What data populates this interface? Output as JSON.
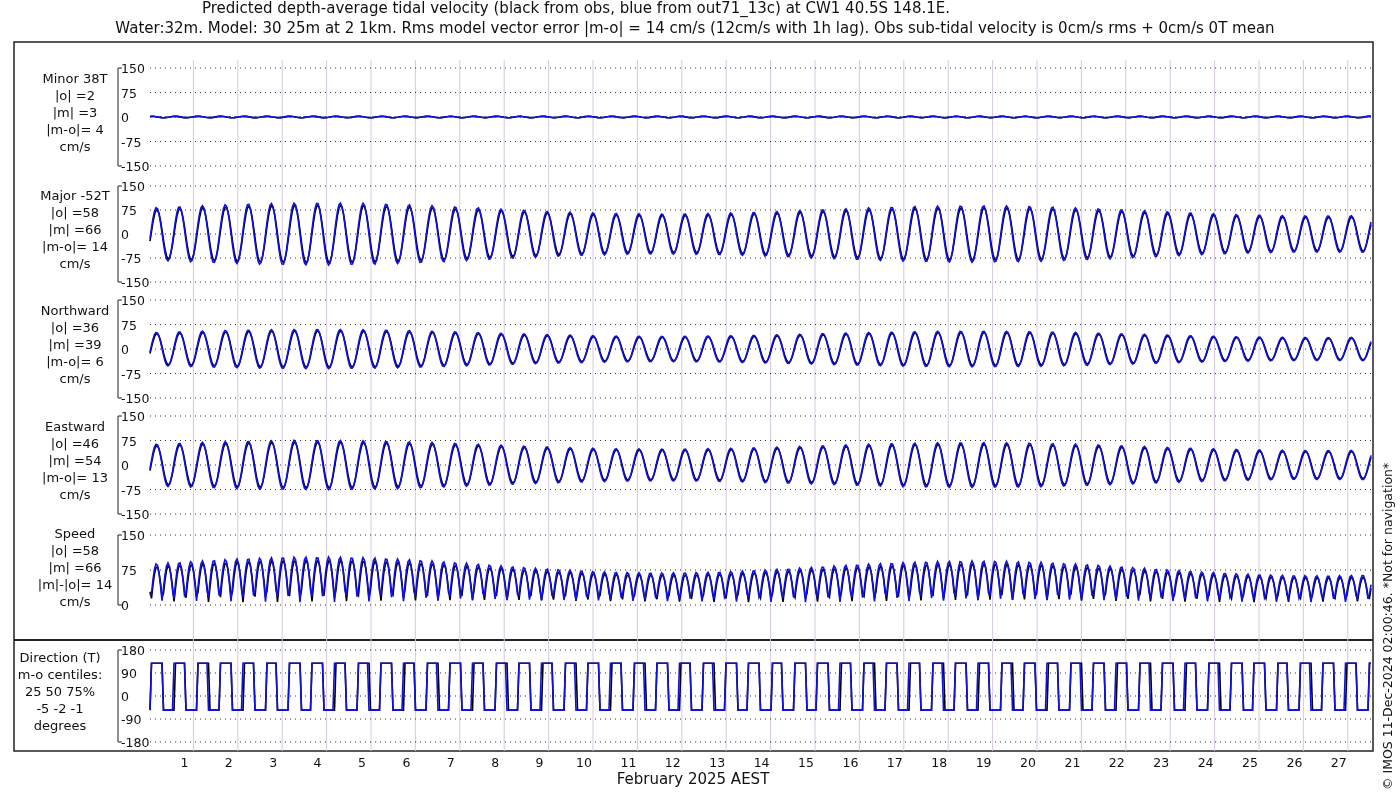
{
  "title_lines": [
    "Predicted depth-average tidal velocity (black from obs, blue from out71_13c) at CW1 40.5S 148.1E.",
    "Water:32m. Model: 30 25m at 2 1km. Rms model vector error |m-o| = 14 cm/s (12cm/s with 1h lag). Obs sub-tidal velocity is 0cm/s rms + 0cm/s 0T mean"
  ],
  "panels": [
    {
      "kind": "signed",
      "label_lines": [
        "Minor 38T",
        "|o| =2",
        "|m| =3",
        "|m-o|= 4",
        "cm/s"
      ],
      "ytick_labels": [
        "150",
        "75",
        "0",
        "-75",
        "-150"
      ]
    },
    {
      "kind": "signed",
      "label_lines": [
        "Major -52T",
        "|o| =58",
        "|m| =66",
        "|m-o|= 14",
        "cm/s"
      ],
      "ytick_labels": [
        "150",
        "75",
        "0",
        "-75",
        "-150"
      ]
    },
    {
      "kind": "signed",
      "label_lines": [
        "Northward",
        "|o| =36",
        "|m| =39",
        "|m-o|= 6",
        "cm/s"
      ],
      "ytick_labels": [
        "150",
        "75",
        "0",
        "-75",
        "-150"
      ]
    },
    {
      "kind": "signed",
      "label_lines": [
        "Eastward",
        "|o| =46",
        "|m| =54",
        "|m-o|= 13",
        "cm/s"
      ],
      "ytick_labels": [
        "150",
        "75",
        "0",
        "-75",
        "-150"
      ]
    },
    {
      "kind": "speed",
      "label_lines": [
        "Speed",
        "|o| =58",
        "|m| =66",
        "|m|-|o|= 14",
        "cm/s"
      ],
      "ytick_labels": [
        "150",
        "75",
        "0"
      ]
    },
    {
      "kind": "direction",
      "label_lines": [
        "Direction (T)",
        "m-o centiles:",
        "25  50  75%",
        "-5 -2 -1",
        "degrees"
      ],
      "ytick_labels": [
        "180",
        "90",
        "0",
        "-90",
        "-180"
      ]
    }
  ],
  "xtick_labels": [
    "1",
    "2",
    "3",
    "4",
    "5",
    "6",
    "7",
    "8",
    "9",
    "10",
    "11",
    "12",
    "13",
    "14",
    "15",
    "16",
    "17",
    "18",
    "19",
    "20",
    "21",
    "22",
    "23",
    "24",
    "25",
    "26",
    "27"
  ],
  "xlabel": "February 2025 AEST",
  "side_note": "© IMOS 11-Dec-2024 02:00:46. *Not for navigation*"
}
